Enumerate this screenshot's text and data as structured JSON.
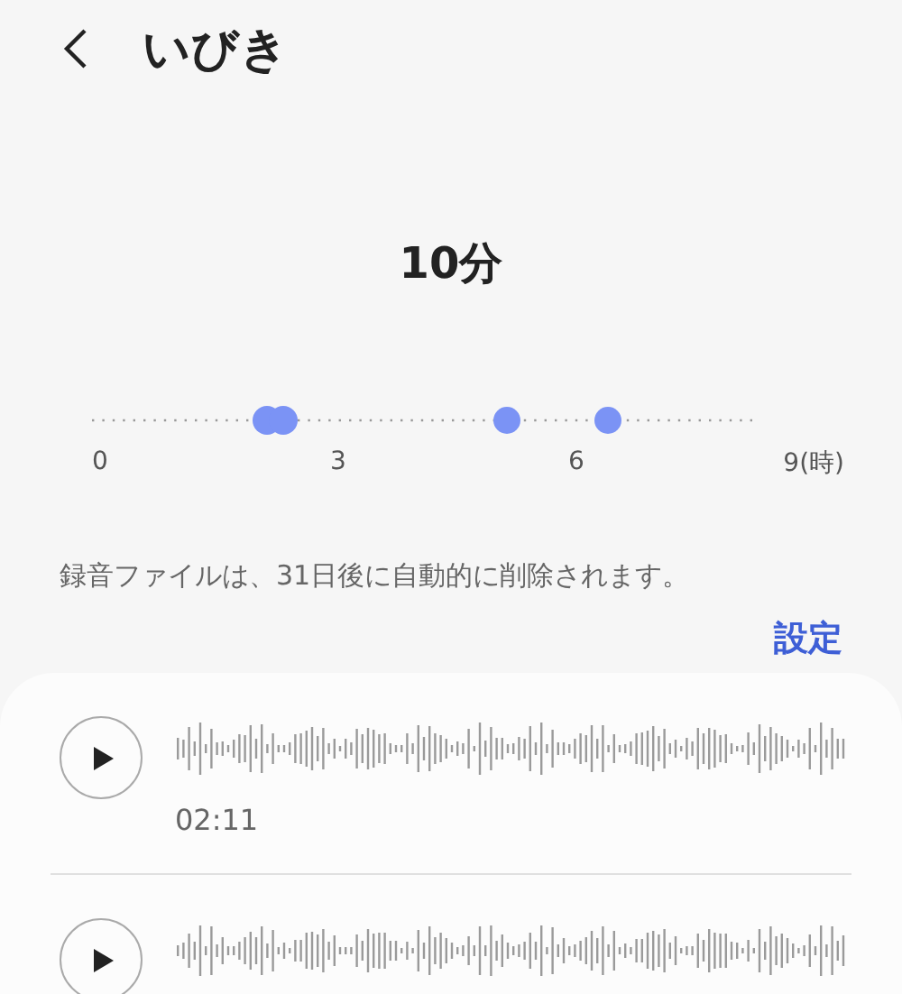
{
  "header": {
    "title": "いびき"
  },
  "total": "10分",
  "timeline": {
    "ticks": [
      "0",
      "3",
      "6",
      "9(時)"
    ]
  },
  "notice": "録音ファイルは、31日後に自動的に削除されます。",
  "settings_link": "設定",
  "recordings": [
    {
      "kind": "recording",
      "time": "02:11"
    },
    {
      "kind": "recording"
    }
  ]
}
